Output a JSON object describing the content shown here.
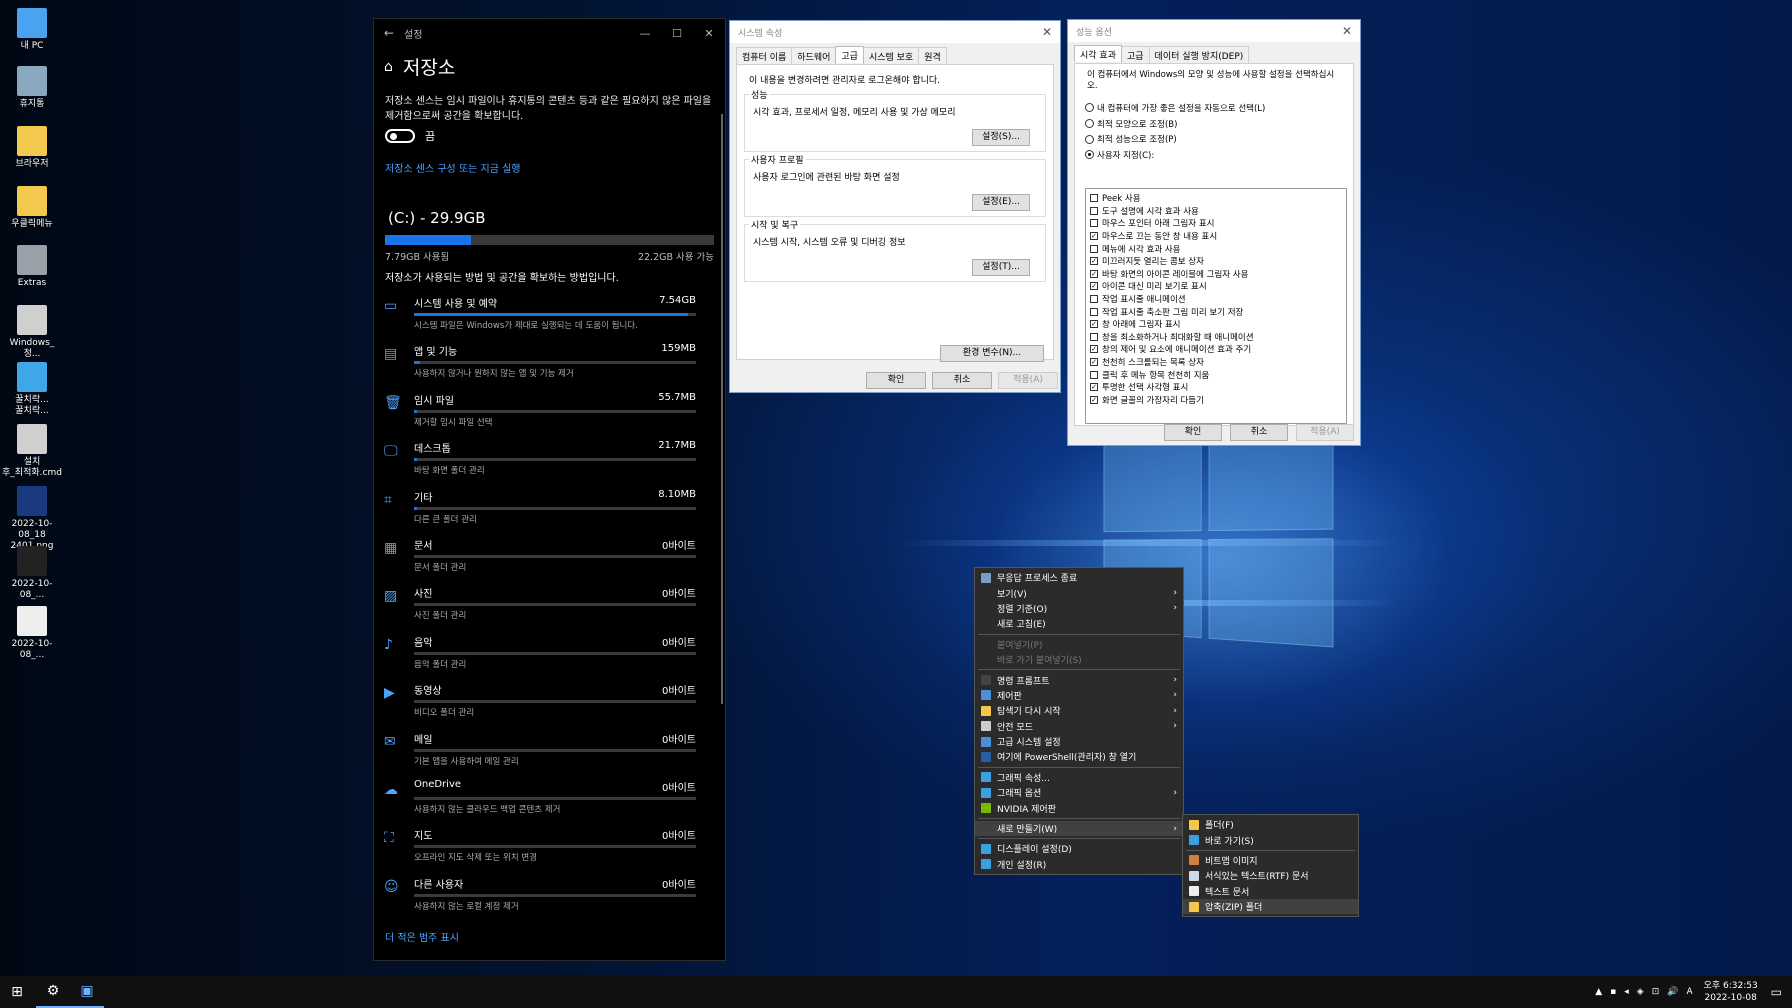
{
  "desktop_icons": [
    {
      "label": "내 PC",
      "icon": "pc-icon",
      "color": "#4aa3f0"
    },
    {
      "label": "휴지통",
      "icon": "recycle-bin-icon",
      "color": "#8aa8c0"
    },
    {
      "label": "브라우저",
      "icon": "folder-icon",
      "color": "#f2c94c"
    },
    {
      "label": "우클릭메뉴",
      "icon": "folder-icon",
      "color": "#f2c94c"
    },
    {
      "label": "Extras",
      "icon": "folder-icon",
      "color": "#9aa0a8"
    },
    {
      "label": "Windows_정...",
      "icon": "settings-file-icon",
      "color": "#d0d0d0"
    },
    {
      "label": "꿀치락...\n꿀치락...",
      "icon": "ie-icon",
      "color": "#3fa7e8"
    },
    {
      "label": "설치\n후_최적화.cmd",
      "icon": "settings-file-icon",
      "color": "#d0d0d0"
    },
    {
      "label": "2022-10-08_18\n2401.png",
      "icon": "image-icon",
      "color": "#1a3a80"
    },
    {
      "label": "2022-10-08_...",
      "icon": "image-icon",
      "color": "#222"
    },
    {
      "label": "2022-10-08_...",
      "icon": "image-icon",
      "color": "#eee"
    }
  ],
  "settings": {
    "window_title": "설정",
    "heading": "저장소",
    "description": "저장소 센스는 임시 파일이나 휴지통의 콘텐츠 등과 같은 필요하지 않은 파일을 제거함으로써 공간을 확보합니다.",
    "toggle_label": "끔",
    "sense_link": "저장소 센스 구성 또는 지금 실행",
    "drive_title": "(C:) - 29.9GB",
    "drive_used_fraction": 0.26,
    "used_label": "7.79GB 사용됨",
    "free_label": "22.2GB 사용 가능",
    "howto": "저장소가 사용되는 방법 및 공간을 확보하는 방법입니다.",
    "categories": [
      {
        "name": "시스템 사용 및 예약",
        "size": "7.54GB",
        "desc": "시스템 파일은 Windows가 제대로 실행되는 데 도움이 됩니다.",
        "icon": "system-icon",
        "glyph": "▭",
        "fill": 0.97
      },
      {
        "name": "앱 및 기능",
        "size": "159MB",
        "desc": "사용하지 않거나 원하지 않는 앱 및 기능 제거",
        "icon": "apps-icon",
        "glyph": "▤",
        "fill": 0.02
      },
      {
        "name": "임시 파일",
        "size": "55.7MB",
        "desc": "제거할 임시 파일 선택",
        "icon": "trash-icon",
        "glyph": "🗑",
        "fill": 0.01
      },
      {
        "name": "데스크톱",
        "size": "21.7MB",
        "desc": "바탕 화면 폴더 관리",
        "icon": "desktop-icon",
        "glyph": "🖵",
        "fill": 0.005
      },
      {
        "name": "기타",
        "size": "8.10MB",
        "desc": "다른 큰 폴더 관리",
        "icon": "other-icon",
        "glyph": "⌗",
        "fill": 0.003
      },
      {
        "name": "문서",
        "size": "0바이트",
        "desc": "문서 폴더 관리",
        "icon": "documents-icon",
        "glyph": "▦",
        "fill": 0
      },
      {
        "name": "사진",
        "size": "0바이트",
        "desc": "사진 폴더 관리",
        "icon": "pictures-icon",
        "glyph": "▨",
        "fill": 0
      },
      {
        "name": "음악",
        "size": "0바이트",
        "desc": "음악 폴더 관리",
        "icon": "music-icon",
        "glyph": "♪",
        "fill": 0
      },
      {
        "name": "동영상",
        "size": "0바이트",
        "desc": "비디오 폴더 관리",
        "icon": "video-icon",
        "glyph": "▶",
        "fill": 0
      },
      {
        "name": "메일",
        "size": "0바이트",
        "desc": "기본 앱을 사용하여 메일 관리",
        "icon": "mail-icon",
        "glyph": "✉",
        "fill": 0
      },
      {
        "name": "OneDrive",
        "size": "0바이트",
        "desc": "사용하지 않는 클라우드 백업 콘텐츠 제거",
        "icon": "cloud-icon",
        "glyph": "☁",
        "fill": 0
      },
      {
        "name": "지도",
        "size": "0바이트",
        "desc": "오프라인 지도 삭제 또는 위치 변경",
        "icon": "map-icon",
        "glyph": "⛶",
        "fill": 0
      },
      {
        "name": "다른 사용자",
        "size": "0바이트",
        "desc": "사용하지 않는 로컬 계정 제거",
        "icon": "user-icon",
        "glyph": "☺",
        "fill": 0
      }
    ],
    "more_link": "더 적은 범주 표시"
  },
  "sysprops": {
    "title": "시스템 속성",
    "tabs": [
      "컴퓨터 이름",
      "하드웨어",
      "고급",
      "시스템 보호",
      "원격"
    ],
    "active_tab": 2,
    "admin_note": "이 내용을 변경하려면 관리자로 로그온해야 합니다.",
    "groups": [
      {
        "title": "성능",
        "desc": "시각 효과, 프로세서 일정, 메모리 사용 및 가상 메모리",
        "button": "설정(S)..."
      },
      {
        "title": "사용자 프로필",
        "desc": "사용자 로그인에 관련된 바탕 화면 설정",
        "button": "설정(E)..."
      },
      {
        "title": "시작 및 복구",
        "desc": "시스템 시작, 시스템 오류 및 디버깅 정보",
        "button": "설정(T)..."
      }
    ],
    "env_button": "환경 변수(N)...",
    "ok": "확인",
    "cancel": "취소",
    "apply": "적용(A)"
  },
  "perfopts": {
    "title": "성능 옵션",
    "tabs": [
      "시각 효과",
      "고급",
      "데이터 실행 방지(DEP)"
    ],
    "active_tab": 0,
    "intro": "이 컴퓨터에서 Windows의 모양 및 성능에 사용할 설정을 선택하십시오.",
    "radios": [
      {
        "label": "내 컴퓨터에 가장 좋은 설정을 자동으로 선택(L)",
        "checked": false
      },
      {
        "label": "최적 모양으로 조정(B)",
        "checked": false
      },
      {
        "label": "최적 성능으로 조정(P)",
        "checked": false
      },
      {
        "label": "사용자 지정(C):",
        "checked": true
      }
    ],
    "checks": [
      {
        "label": "Peek 사용",
        "checked": false
      },
      {
        "label": "도구 설명에 시각 효과 사용",
        "checked": false
      },
      {
        "label": "마우스 포인터 아래 그림자 표시",
        "checked": false
      },
      {
        "label": "마우스로 끄는 동안 창 내용 표시",
        "checked": true
      },
      {
        "label": "메뉴에 시각 효과 사용",
        "checked": false
      },
      {
        "label": "미끄러지듯 열리는 콤보 상자",
        "checked": true
      },
      {
        "label": "바탕 화면의 아이콘 레이블에 그림자 사용",
        "checked": true
      },
      {
        "label": "아이콘 대신 미리 보기로 표시",
        "checked": true
      },
      {
        "label": "작업 표시줄 애니메이션",
        "checked": false
      },
      {
        "label": "작업 표시줄 축소판 그림 미리 보기 저장",
        "checked": false
      },
      {
        "label": "창 아래에 그림자 표시",
        "checked": true
      },
      {
        "label": "창을 최소화하거나 최대화할 때 애니메이션",
        "checked": false
      },
      {
        "label": "창의 제어 및 요소에 애니메이션 효과 주기",
        "checked": true
      },
      {
        "label": "천천히 스크롤되는 목록 상자",
        "checked": true
      },
      {
        "label": "클릭 후 메뉴 항목 천천히 지움",
        "checked": false
      },
      {
        "label": "투명한 선택 사각형 표시",
        "checked": true
      },
      {
        "label": "화면 글꼴의 가장자리 다듬기",
        "checked": true
      }
    ],
    "ok": "확인",
    "cancel": "취소",
    "apply": "적용(A)"
  },
  "context_menu": [
    {
      "label": "무응답 프로세스 종료",
      "icon": "process-icon",
      "color": "#7a9cc6",
      "sub": false,
      "dis": false
    },
    {
      "label": "보기(V)",
      "icon": "",
      "color": "",
      "sub": true,
      "dis": false
    },
    {
      "label": "정렬 기준(O)",
      "icon": "",
      "color": "",
      "sub": true,
      "dis": false
    },
    {
      "label": "새로 고침(E)",
      "icon": "",
      "color": "",
      "sub": false,
      "dis": false
    },
    {
      "sep": true
    },
    {
      "label": "붙여넣기(P)",
      "icon": "",
      "color": "",
      "sub": false,
      "dis": true
    },
    {
      "label": "바로 가기 붙여넣기(S)",
      "icon": "",
      "color": "",
      "sub": false,
      "dis": true
    },
    {
      "sep": true
    },
    {
      "label": "명령 프롬프트",
      "icon": "cmd-icon",
      "color": "#444",
      "sub": true,
      "dis": false
    },
    {
      "label": "제어판",
      "icon": "control-panel-icon",
      "color": "#4a90d9",
      "sub": true,
      "dis": false
    },
    {
      "label": "탐색기 다시 시작",
      "icon": "explorer-icon",
      "color": "#f2c94c",
      "sub": true,
      "dis": false
    },
    {
      "label": "안전 모드",
      "icon": "gear-icon",
      "color": "#ccc",
      "sub": true,
      "dis": false
    },
    {
      "label": "고급 시스템 설정",
      "icon": "system-settings-icon",
      "color": "#4a90d9",
      "sub": false,
      "dis": false
    },
    {
      "label": "여기에 PowerShell(관리자) 창 열기",
      "icon": "powershell-icon",
      "color": "#2a5ca8",
      "sub": false,
      "dis": false
    },
    {
      "sep": true
    },
    {
      "label": "그래픽 속성...",
      "icon": "graphics-icon",
      "color": "#3aa0e0",
      "sub": false,
      "dis": false
    },
    {
      "label": "그래픽 옵션",
      "icon": "graphics-icon",
      "color": "#3aa0e0",
      "sub": true,
      "dis": false
    },
    {
      "label": "NVIDIA 제어판",
      "icon": "nvidia-icon",
      "color": "#76b900",
      "sub": false,
      "dis": false
    },
    {
      "sep": true
    },
    {
      "label": "새로 만들기(W)",
      "icon": "",
      "color": "",
      "sub": true,
      "dis": false,
      "hl": true
    },
    {
      "sep": true
    },
    {
      "label": "디스플레이 설정(D)",
      "icon": "display-icon",
      "color": "#3aa0e0",
      "sub": false,
      "dis": false
    },
    {
      "label": "개인 설정(R)",
      "icon": "personalize-icon",
      "color": "#3aa0e0",
      "sub": false,
      "dis": false
    }
  ],
  "new_submenu": [
    {
      "label": "폴더(F)",
      "icon": "folder-icon",
      "color": "#f2c94c"
    },
    {
      "label": "바로 가기(S)",
      "icon": "shortcut-icon",
      "color": "#3aa0e0"
    },
    {
      "sep": true
    },
    {
      "label": "비트맵 이미지",
      "icon": "bitmap-icon",
      "color": "#d08040"
    },
    {
      "label": "서식있는 텍스트(RTF) 문서",
      "icon": "rtf-icon",
      "color": "#cfd8e6"
    },
    {
      "label": "텍스트 문서",
      "icon": "text-icon",
      "color": "#eee"
    },
    {
      "label": "압축(ZIP) 폴더",
      "icon": "zip-folder-icon",
      "color": "#f2c94c",
      "hl": true
    }
  ],
  "taskbar": {
    "start": "⊞",
    "settings_glyph": "⚙",
    "app_glyph": "▣",
    "tray_glyphs": [
      "▲",
      "▪",
      "◂",
      "◈",
      "⊡",
      "🔊",
      "A"
    ],
    "time": "오후 6:32:53",
    "date": "2022-10-08",
    "notify_glyph": "▭"
  }
}
